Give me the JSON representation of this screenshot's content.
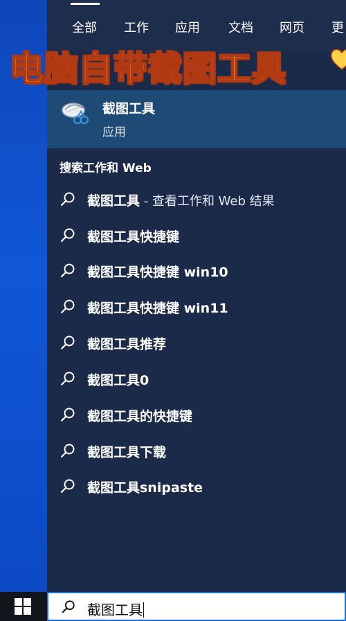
{
  "tabs": [
    {
      "label": "全部"
    },
    {
      "label": "工作"
    },
    {
      "label": "应用"
    },
    {
      "label": "文档"
    },
    {
      "label": "网页"
    },
    {
      "label": "更"
    }
  ],
  "overlay": {
    "title": "电脑自带截图工具",
    "heart_color": "#ffd24a"
  },
  "best_match": {
    "name": "截图工具",
    "type": "应用",
    "icon": "snipping-tool-icon"
  },
  "section": {
    "header": "搜索工作和 Web"
  },
  "suggestions": [
    {
      "text": "截图工具",
      "sub": " - 查看工作和 Web 结果"
    },
    {
      "text": "截图工具快捷键",
      "sub": ""
    },
    {
      "text": "截图工具快捷键 win10",
      "sub": ""
    },
    {
      "text": "截图工具快捷键 win11",
      "sub": ""
    },
    {
      "text": "截图工具推荐",
      "sub": ""
    },
    {
      "text": "截图工具0",
      "sub": ""
    },
    {
      "text": "截图工具的快捷键",
      "sub": ""
    },
    {
      "text": "截图工具下载",
      "sub": ""
    },
    {
      "text": "截图工具snipaste",
      "sub": ""
    }
  ],
  "search_box": {
    "value": "截图工具",
    "icon": "search-icon"
  },
  "taskbar": {
    "start_icon": "windows-logo-icon"
  },
  "colors": {
    "panel_bg": "#1c2a4a",
    "best_match_bg": "#1e4b75",
    "desktop_blue": "#1057d6",
    "overlay_text": "#ffd85a",
    "overlay_outline": "#b23a12"
  }
}
